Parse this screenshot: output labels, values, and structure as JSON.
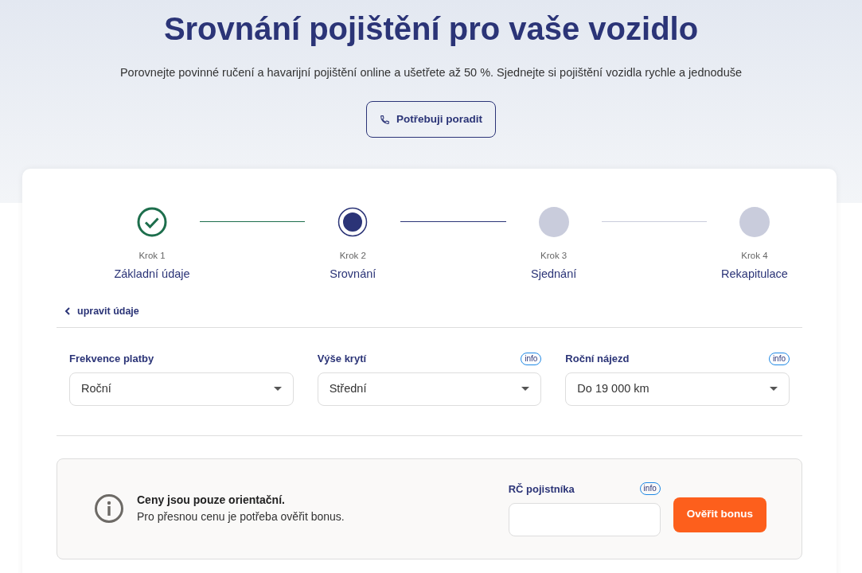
{
  "header": {
    "title": "Srovnání pojištění pro vaše vozidlo",
    "subtitle": "Porovnejte povinné ručení a havarijní pojištění online a ušetřete až 50 %. Sjednejte si pojištění vozidla rychle a jednoduše",
    "help_button": "Potřebuji poradit"
  },
  "steps": [
    {
      "number": "Krok 1",
      "label": "Základní údaje",
      "completed": true,
      "selected": false
    },
    {
      "number": "Krok 2",
      "label": "Srovnání",
      "completed": false,
      "selected": true
    },
    {
      "number": "Krok 3",
      "label": "Sjednání",
      "completed": false,
      "selected": false
    },
    {
      "number": "Krok 4",
      "label": "Rekapitulace",
      "completed": false,
      "selected": false
    }
  ],
  "back_link": "upravit údaje",
  "filters": [
    {
      "label": "Frekvence platby",
      "value": "Roční"
    },
    {
      "label": "Výše krytí",
      "value": "Střední",
      "info": "info"
    },
    {
      "label": "Roční nájezd",
      "value": "Do 19 000 km",
      "info": "info"
    }
  ],
  "notice": {
    "title": "Ceny jsou pouze orientační.",
    "text": "Pro přesnou cenu je potřeba ověřit bonus.",
    "field_label": "RČ pojistníka",
    "field_info": "info",
    "button": "Ověřit bonus"
  }
}
